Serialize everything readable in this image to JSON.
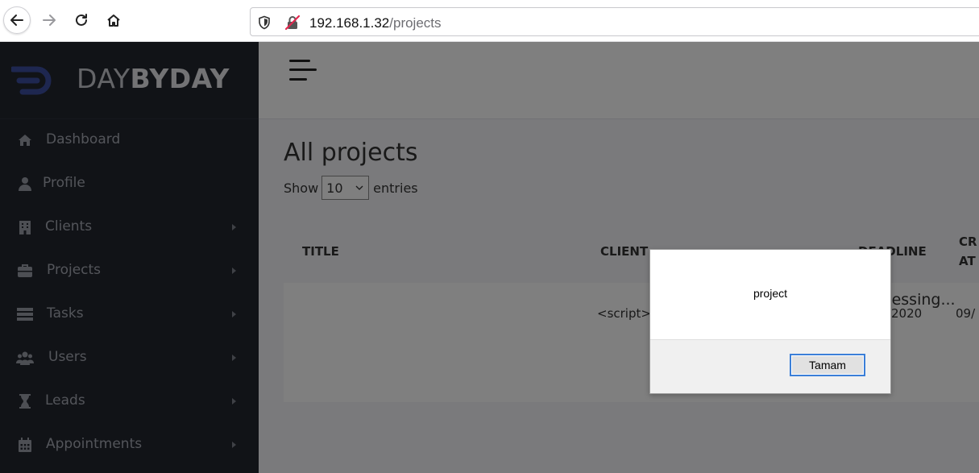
{
  "browser": {
    "url_host": "192.168.1.32",
    "url_path": "/projects"
  },
  "sidebar": {
    "brand_light": "DAY",
    "brand_bold": "BYDAY",
    "items": [
      {
        "label": "Dashboard",
        "icon": "home-icon",
        "has_submenu": false
      },
      {
        "label": "Profile",
        "icon": "user-icon",
        "has_submenu": false
      },
      {
        "label": "Clients",
        "icon": "building-icon",
        "has_submenu": true
      },
      {
        "label": "Projects",
        "icon": "briefcase-icon",
        "has_submenu": true
      },
      {
        "label": "Tasks",
        "icon": "list-icon",
        "has_submenu": true
      },
      {
        "label": "Users",
        "icon": "users-icon",
        "has_submenu": true
      },
      {
        "label": "Leads",
        "icon": "hourglass-icon",
        "has_submenu": true
      },
      {
        "label": "Appointments",
        "icon": "calendar-icon",
        "has_submenu": true
      }
    ]
  },
  "main": {
    "title": "All projects",
    "show_label": "Show",
    "entries_value": "10",
    "entries_label": "entries",
    "columns": {
      "title": "TITLE",
      "client": "CLIENT",
      "deadline": "DEADLINE",
      "created_line1": "CR",
      "created_line2": "AT"
    },
    "row": {
      "client": "<script>a",
      "processing": "Processing...",
      "deadline": "2020",
      "created": "09/"
    }
  },
  "dialog": {
    "message": "project",
    "ok_label": "Tamam"
  },
  "colors": {
    "sidebar_bg": "#23262f",
    "brand_accent": "#3d4fa0",
    "dialog_button_border": "#3b7fd8"
  }
}
